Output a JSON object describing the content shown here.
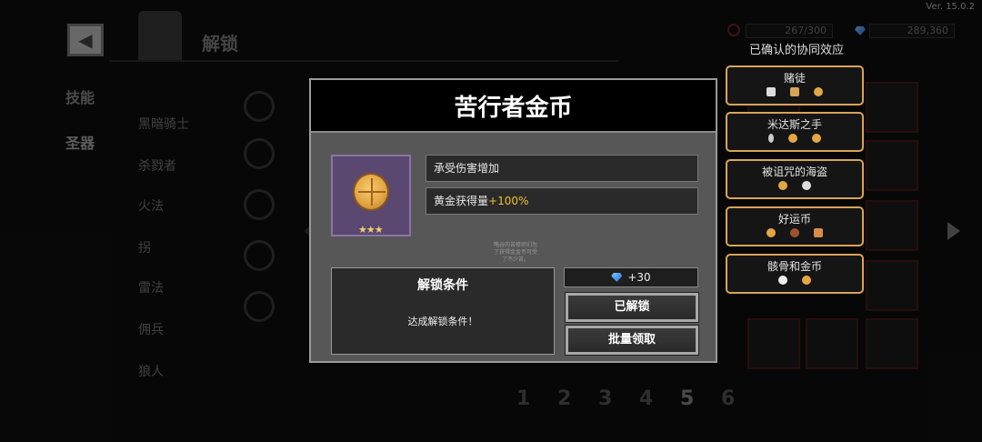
{
  "version": "Ver. 15.0.2",
  "header": {
    "title": "解锁"
  },
  "left_tabs": [
    "技能",
    "圣器"
  ],
  "class_list": [
    "黑暗骑士",
    "杀戮者",
    "火法",
    "拐",
    "雷法",
    "佣兵",
    "狼人"
  ],
  "counters": {
    "first": "267/300",
    "second": "289,360"
  },
  "pager": [
    "1",
    "2",
    "3",
    "4",
    "5",
    "6"
  ],
  "synergy": {
    "header": "已确认的协同效应",
    "items": [
      {
        "name": "赌徒"
      },
      {
        "name": "米达斯之手"
      },
      {
        "name": "被诅咒的海盗"
      },
      {
        "name": "好运币"
      },
      {
        "name": "骸骨和金币"
      }
    ]
  },
  "modal": {
    "title": "苦行者金币",
    "stars": "★★★",
    "effect1": "承受伤害增加",
    "effect2_label": "黄金获得量",
    "effect2_value": "+100%",
    "flavor": "略谷的苦修师们为了获得金金币可受了不少苦。",
    "condition_title": "解锁条件",
    "condition_status": "达成解锁条件！",
    "reward": "+30",
    "btn_unlocked": "已解锁",
    "btn_batch": "批量领取"
  },
  "colors": {
    "gold_border": "#d9a35a",
    "highlight": "#f0c030",
    "modal_bg": "#575757"
  }
}
